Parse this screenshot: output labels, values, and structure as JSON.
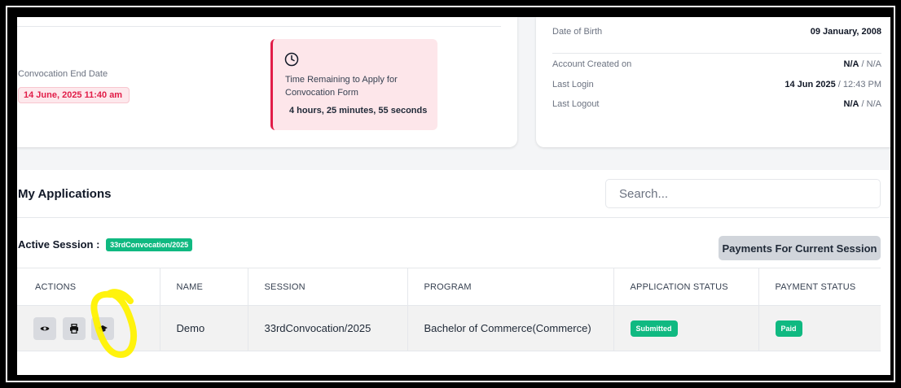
{
  "convocation": {
    "end_label": "Convocation End Date",
    "end_value": "14 June, 2025 11:40 am",
    "timer_label": "Time Remaining to Apply for Convocation Form",
    "timer_value": "4 hours, 25 minutes, 55 seconds"
  },
  "account": {
    "dob_label": "Date of Birth",
    "dob_value": "09 January, 2008",
    "created_label": "Account Created on",
    "created_date": "N/A",
    "created_time": "N/A",
    "last_login_label": "Last Login",
    "last_login_date": "14 Jun 2025",
    "last_login_time": "12:43 PM",
    "last_logout_label": "Last Logout",
    "last_logout_date": "N/A",
    "last_logout_time": "N/A",
    "separator": " / "
  },
  "applications": {
    "title": "My Applications",
    "search_placeholder": "Search...",
    "active_session_label": "Active Session :",
    "active_session_value": "33rdConvocation/2025",
    "payments_button": "Payments For Current Session",
    "columns": [
      "ACTIONS",
      "NAME",
      "SESSION",
      "PROGRAM",
      "APPLICATION STATUS",
      "PAYMENT STATUS"
    ],
    "rows": [
      {
        "name": "Demo",
        "session": "33rdConvocation/2025",
        "program": "Bachelor of Commerce(Commerce)",
        "application_status": "Submitted",
        "payment_status": "Paid"
      }
    ],
    "actions": [
      "eye-icon",
      "printer-icon",
      "graduation-cap-icon"
    ]
  },
  "colors": {
    "accent_red": "#e11d48",
    "badge_green": "#10b981",
    "highlight_yellow": "#fff200"
  }
}
